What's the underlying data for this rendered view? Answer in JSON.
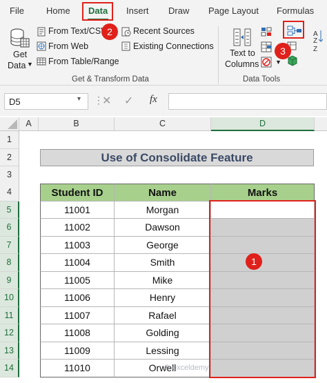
{
  "ribbon_tabs": [
    "File",
    "Home",
    "Data",
    "Insert",
    "Draw",
    "Page Layout",
    "Formulas"
  ],
  "active_tab": "Data",
  "get_transform": {
    "get_data": "Get",
    "get_data_2": "Data",
    "from_text_csv": "From Text/CSV",
    "from_web": "From Web",
    "from_table_range": "From Table/Range",
    "recent_sources": "Recent Sources",
    "existing_connections": "Existing Connections",
    "group_label": "Get & Transform Data"
  },
  "data_tools": {
    "text_to_columns_1": "Text to",
    "text_to_columns_2": "Columns",
    "group_label": "Data Tools"
  },
  "formula_bar": {
    "name_box": "D5",
    "fx_label": "fx",
    "formula": ""
  },
  "columns": [
    "A",
    "B",
    "C",
    "D"
  ],
  "rows": [
    "1",
    "2",
    "3",
    "4",
    "5",
    "6",
    "7",
    "8",
    "9",
    "10",
    "11",
    "12",
    "13",
    "14"
  ],
  "sheet": {
    "title": "Use of Consolidate Feature",
    "headers": [
      "Student ID",
      "Name",
      "Marks"
    ],
    "records": [
      {
        "id": "11001",
        "name": "Morgan",
        "marks": ""
      },
      {
        "id": "11002",
        "name": "Dawson",
        "marks": ""
      },
      {
        "id": "11003",
        "name": "George",
        "marks": ""
      },
      {
        "id": "11004",
        "name": "Smith",
        "marks": ""
      },
      {
        "id": "11005",
        "name": "Mike",
        "marks": ""
      },
      {
        "id": "11006",
        "name": "Henry",
        "marks": ""
      },
      {
        "id": "11007",
        "name": "Rafael",
        "marks": ""
      },
      {
        "id": "11008",
        "name": "Golding",
        "marks": ""
      },
      {
        "id": "11009",
        "name": "Lessing",
        "marks": ""
      },
      {
        "id": "11010",
        "name": "Orwell",
        "marks": ""
      }
    ]
  },
  "callouts": [
    "1",
    "2",
    "3"
  ],
  "watermark": "exceldemy",
  "colors": {
    "accent_green": "#1e6e3c",
    "header_fill": "#a8d08d",
    "highlight_red": "#e0201a"
  }
}
